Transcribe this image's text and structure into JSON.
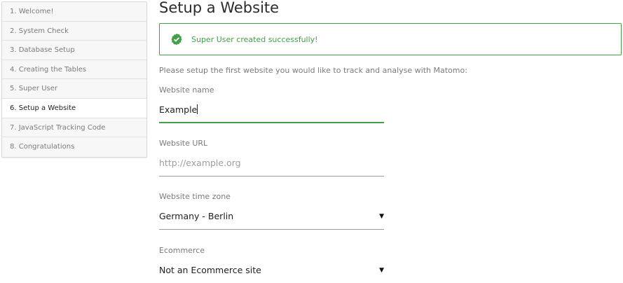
{
  "steps": [
    "1. Welcome!",
    "2. System Check",
    "3. Database Setup",
    "4. Creating the Tables",
    "5. Super User",
    "6. Setup a Website",
    "7. JavaScript Tracking Code",
    "8. Congratulations"
  ],
  "page_title": "Setup a Website",
  "notification": {
    "text": "Super User created successfully!",
    "icon": "check-badge-icon",
    "color": "#43a047"
  },
  "intro": "Please setup the first website you would like to track and analyse with Matomo:",
  "fields": {
    "website_name": {
      "label": "Website name",
      "value": "Example"
    },
    "website_url": {
      "label": "Website URL",
      "placeholder": "http://example.org"
    },
    "timezone": {
      "label": "Website time zone",
      "value": "Germany - Berlin"
    },
    "ecommerce": {
      "label": "Ecommerce",
      "value": "Not an Ecommerce site"
    }
  }
}
